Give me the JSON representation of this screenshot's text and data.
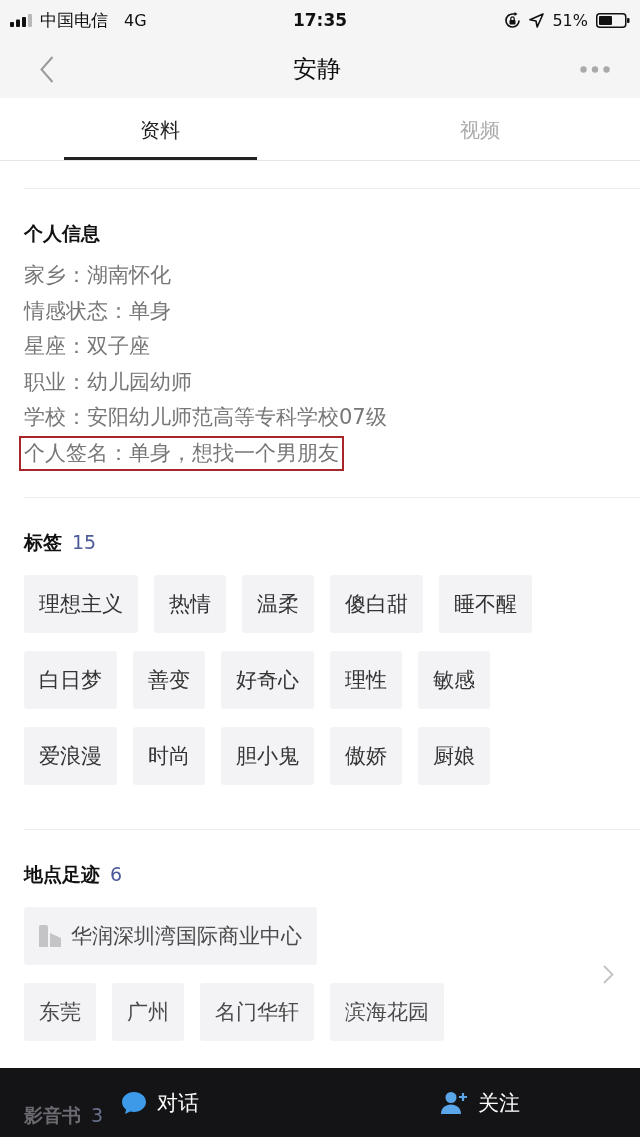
{
  "status_bar": {
    "carrier": "中国电信",
    "network": "4G",
    "time": "17:35",
    "battery": "51%"
  },
  "nav_bar": {
    "title": "安静"
  },
  "tabs": [
    {
      "label": "资料",
      "selected": true
    },
    {
      "label": "视频",
      "selected": false
    }
  ],
  "personal_info": {
    "heading": "个人信息",
    "lines": [
      {
        "text": "家乡：湖南怀化",
        "highlighted": false
      },
      {
        "text": "情感状态：单身",
        "highlighted": false
      },
      {
        "text": "星座：双子座",
        "highlighted": false
      },
      {
        "text": "职业：幼儿园幼师",
        "highlighted": false
      },
      {
        "text": "学校：安阳幼儿师范高等专科学校07级",
        "highlighted": false
      },
      {
        "text": "个人签名：单身，想找一个男朋友",
        "highlighted": true
      }
    ]
  },
  "tags": {
    "heading": "标签",
    "count": "15",
    "items": [
      "理想主义",
      "热情",
      "温柔",
      "傻白甜",
      "睡不醒",
      "白日梦",
      "善变",
      "好奇心",
      "理性",
      "敏感",
      "爱浪漫",
      "时尚",
      "胆小鬼",
      "傲娇",
      "厨娘"
    ]
  },
  "places": {
    "heading": "地点足迹",
    "count": "6",
    "items": [
      {
        "name": "华润深圳湾国际商业中心",
        "kind": "building"
      },
      {
        "name": "东莞",
        "kind": "city"
      },
      {
        "name": "广州",
        "kind": "city"
      },
      {
        "name": "名门华轩",
        "kind": "city"
      },
      {
        "name": "滨海花园",
        "kind": "city"
      }
    ]
  },
  "next_section": {
    "heading": "影音书",
    "count": "3"
  },
  "bottom_bar": {
    "actions": [
      {
        "label": "对话",
        "kind": "chat"
      },
      {
        "label": "关注",
        "kind": "follow"
      }
    ]
  }
}
